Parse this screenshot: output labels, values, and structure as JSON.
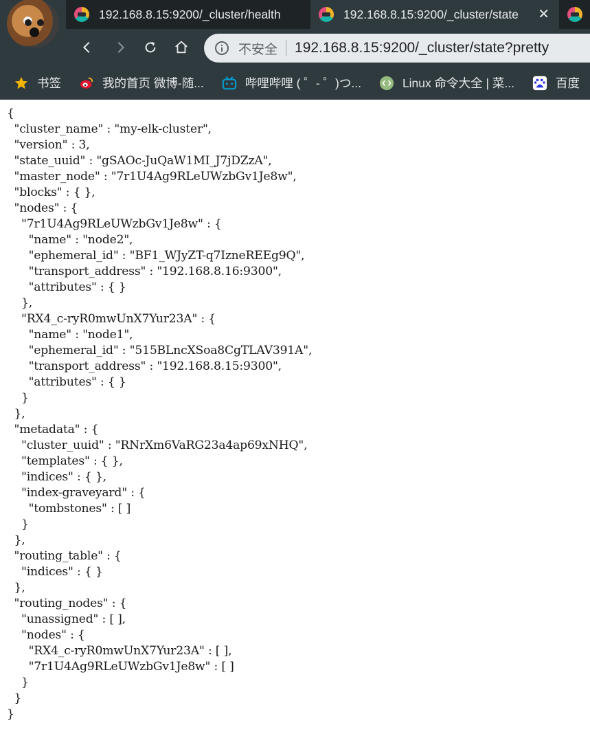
{
  "tabs": [
    {
      "title": "192.168.8.15:9200/_cluster/health",
      "active": false
    },
    {
      "title": "192.168.8.15:9200/_cluster/state",
      "active": true
    },
    {
      "title": "",
      "active": false
    }
  ],
  "toolbar": {
    "security_label": "不安全",
    "url": "192.168.8.15:9200/_cluster/state?pretty"
  },
  "bookmarks": [
    {
      "icon": "star-icon",
      "label": "书签"
    },
    {
      "icon": "weibo-icon",
      "label": "我的首页 微博-随..."
    },
    {
      "icon": "bilibili-icon",
      "label": "哔哩哔哩 ( ゜- ゜)つ..."
    },
    {
      "icon": "runoob-icon",
      "label": "Linux 命令大全 | 菜..."
    },
    {
      "icon": "baidu-icon",
      "label": "百度"
    }
  ],
  "json_body": "{\n  \"cluster_name\" : \"my-elk-cluster\",\n  \"version\" : 3,\n  \"state_uuid\" : \"gSAOc-JuQaW1MI_J7jDZzA\",\n  \"master_node\" : \"7r1U4Ag9RLeUWzbGv1Je8w\",\n  \"blocks\" : { },\n  \"nodes\" : {\n    \"7r1U4Ag9RLeUWzbGv1Je8w\" : {\n      \"name\" : \"node2\",\n      \"ephemeral_id\" : \"BF1_WJyZT-q7IzneREEg9Q\",\n      \"transport_address\" : \"192.168.8.16:9300\",\n      \"attributes\" : { }\n    },\n    \"RX4_c-ryR0mwUnX7Yur23A\" : {\n      \"name\" : \"node1\",\n      \"ephemeral_id\" : \"515BLncXSoa8CgTLAV391A\",\n      \"transport_address\" : \"192.168.8.15:9300\",\n      \"attributes\" : { }\n    }\n  },\n  \"metadata\" : {\n    \"cluster_uuid\" : \"RNrXm6VaRG23a4ap69xNHQ\",\n    \"templates\" : { },\n    \"indices\" : { },\n    \"index-graveyard\" : {\n      \"tombstones\" : [ ]\n    }\n  },\n  \"routing_table\" : {\n    \"indices\" : { }\n  },\n  \"routing_nodes\" : {\n    \"unassigned\" : [ ],\n    \"nodes\" : {\n      \"RX4_c-ryR0mwUnX7Yur23A\" : [ ],\n      \"7r1U4Ag9RLeUWzbGv1Je8w\" : [ ]\n    }\n  }\n}"
}
